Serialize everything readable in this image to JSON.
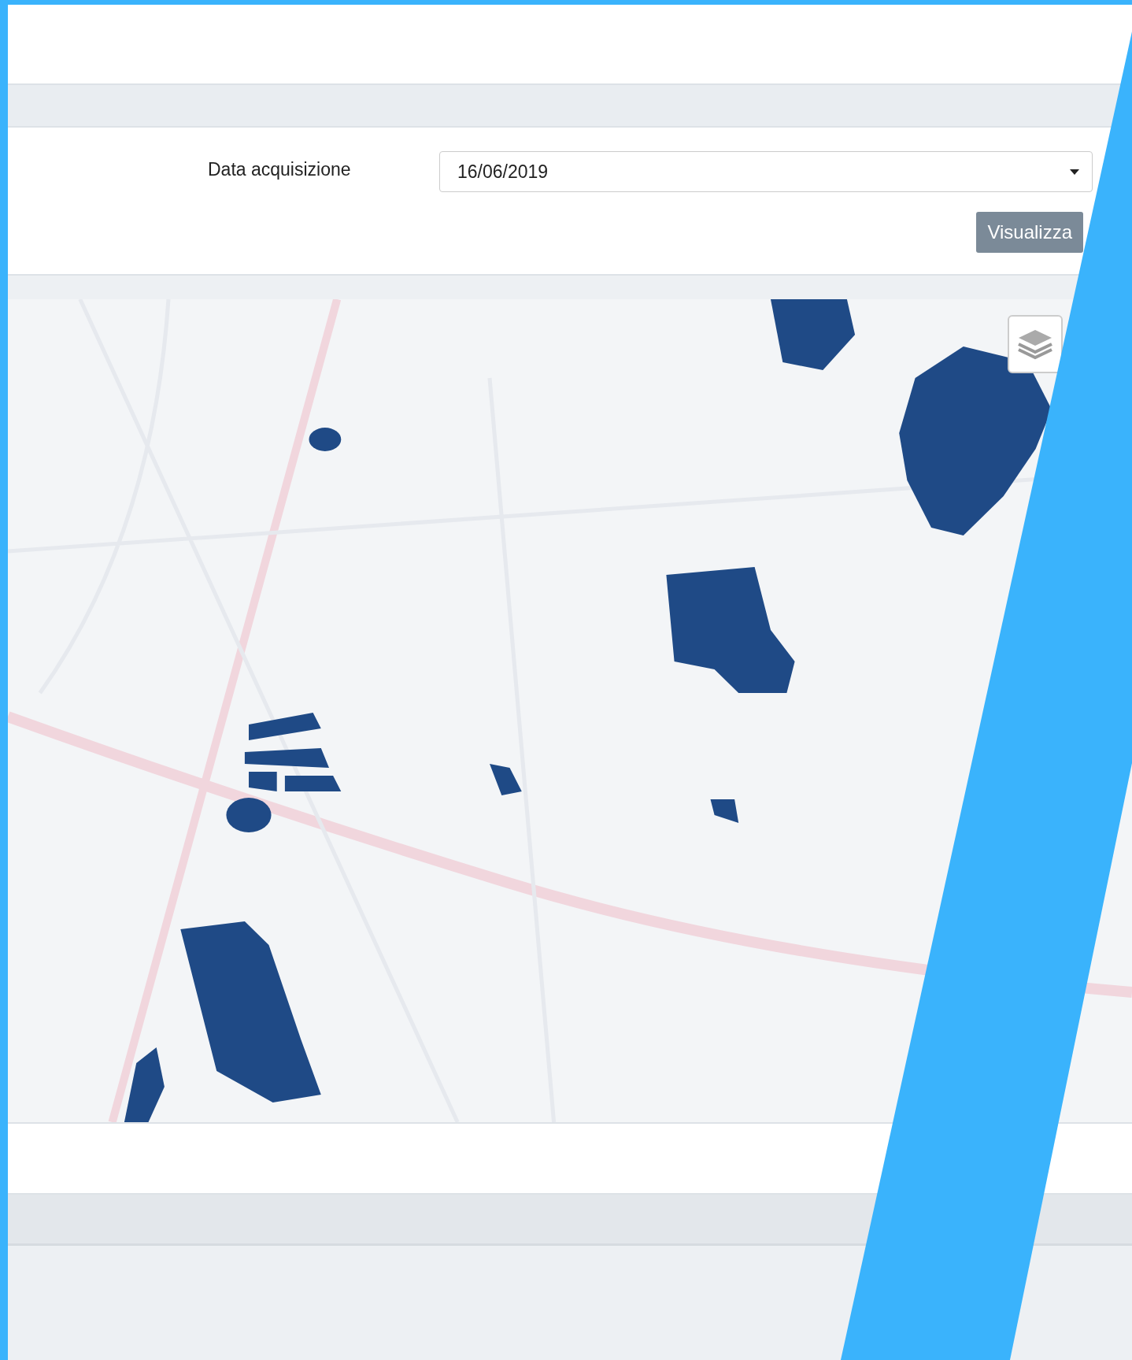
{
  "form": {
    "date_label": "Data acquisizione",
    "date_value": "16/06/2019",
    "submit_button": "Visualizza"
  }
}
